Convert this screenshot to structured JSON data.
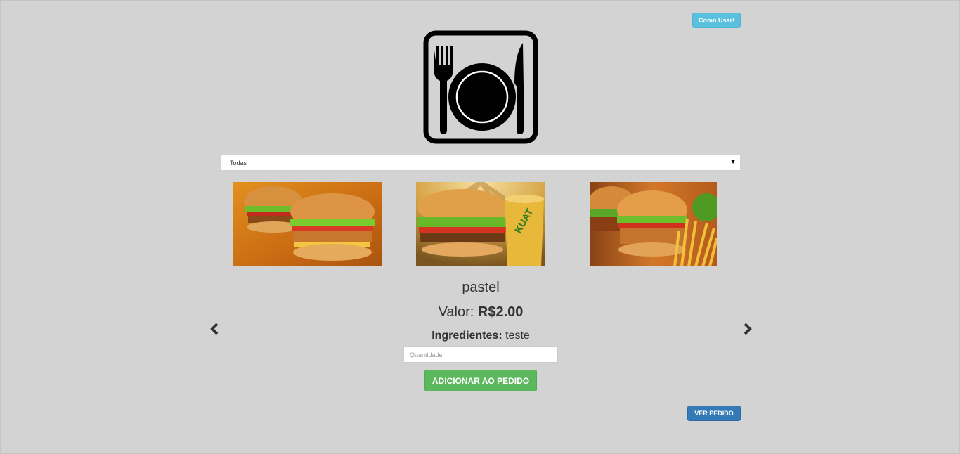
{
  "header": {
    "help_button_label": "Como Usar!"
  },
  "logo": {
    "icon": "plate-fork-knife-icon"
  },
  "category_filter": {
    "selected": "Todas"
  },
  "carousel": {
    "images": [
      {
        "icon": "burger-photo-double"
      },
      {
        "icon": "burger-with-kuat-soda-photo"
      },
      {
        "icon": "burger-with-fries-photo"
      }
    ],
    "prev_icon": "chevron-left-icon",
    "next_icon": "chevron-right-icon"
  },
  "product": {
    "name": "pastel",
    "price_label": "Valor:",
    "price_value": "R$2.00",
    "ingredients_label": "Ingredientes:",
    "ingredients_value": "teste"
  },
  "order_form": {
    "quantity_placeholder": "Quantidade",
    "add_button_label": "ADICIONAR AO PEDIDO"
  },
  "footer": {
    "view_order_label": "VER PEDIDO"
  },
  "colors": {
    "background": "#d3d3d3",
    "help_button": "#5bc0de",
    "add_button": "#5cb85c",
    "view_button": "#337ab7"
  }
}
